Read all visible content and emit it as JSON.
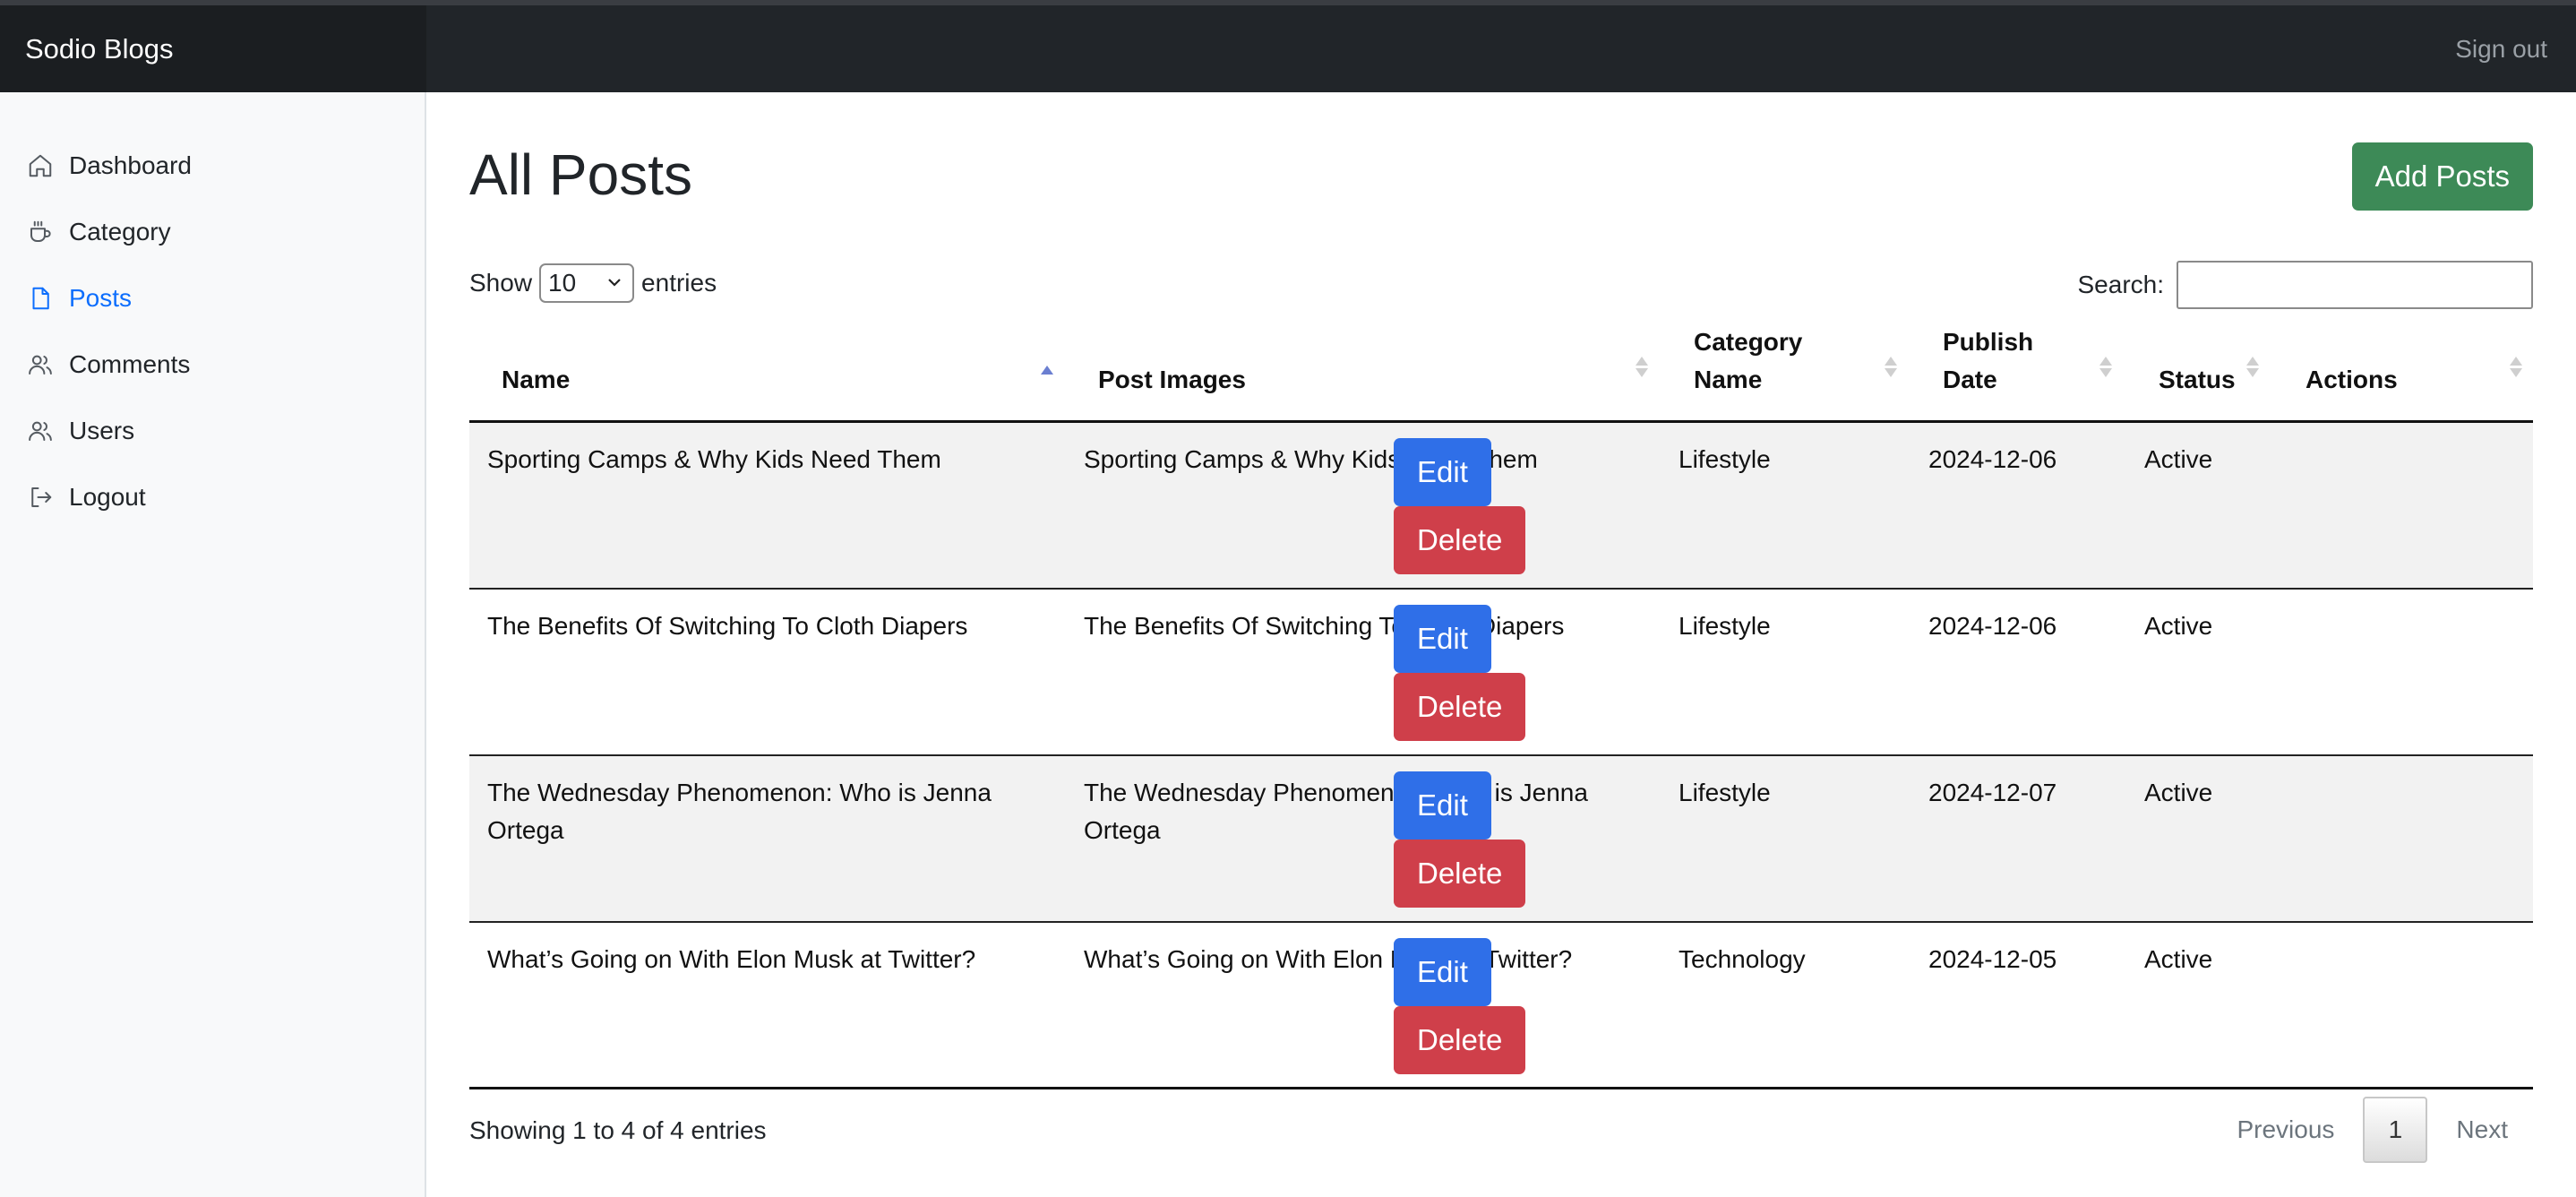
{
  "app": {
    "brand": "Sodio Blogs",
    "signout": "Sign out"
  },
  "sidebar": {
    "items": [
      {
        "label": "Dashboard",
        "icon": "home-icon"
      },
      {
        "label": "Category",
        "icon": "coffee-cup-icon"
      },
      {
        "label": "Posts",
        "icon": "document-icon",
        "active": true
      },
      {
        "label": "Comments",
        "icon": "users-icon"
      },
      {
        "label": "Users",
        "icon": "users-icon"
      },
      {
        "label": "Logout",
        "icon": "logout-icon"
      }
    ]
  },
  "main": {
    "title": "All Posts",
    "add_button": "Add Posts",
    "show_label": "Show",
    "entries_label": "entries",
    "entries_value": "10",
    "search_label": "Search:",
    "search_value": ""
  },
  "table": {
    "columns": [
      "Name",
      "Post Images",
      "Category Name",
      "Publish Date",
      "Status",
      "Actions"
    ],
    "rows": [
      {
        "name": "Sporting Camps & Why Kids Need Them",
        "image": "Sporting Camps & Why Kids Need Them",
        "category": "Lifestyle",
        "date": "2024-12-06",
        "status": "Active",
        "edit": "Edit",
        "delete": "Delete"
      },
      {
        "name": "The Benefits Of Switching To Cloth Diapers",
        "image": "The Benefits Of Switching To Cloth Diapers",
        "category": "Lifestyle",
        "date": "2024-12-06",
        "status": "Active",
        "edit": "Edit",
        "delete": "Delete"
      },
      {
        "name": "The Wednesday Phenomenon: Who is Jenna Ortega",
        "image": "The Wednesday Phenomenon: Who is Jenna Ortega",
        "category": "Lifestyle",
        "date": "2024-12-07",
        "status": "Active",
        "edit": "Edit",
        "delete": "Delete"
      },
      {
        "name": "What’s Going on With Elon Musk at Twitter?",
        "image": "What’s Going on With Elon Musk at Twitter?",
        "category": "Technology",
        "date": "2024-12-05",
        "status": "Active",
        "edit": "Edit",
        "delete": "Delete"
      }
    ]
  },
  "footer": {
    "info": "Showing 1 to 4 of 4 entries",
    "previous": "Previous",
    "page": "1",
    "next": "Next"
  },
  "colors": {
    "navbar": "#212529",
    "active_link": "#0d6efd",
    "add_button": "#3d8a57",
    "edit_button": "#2f6fe8",
    "delete_button": "#cf3f4a"
  }
}
